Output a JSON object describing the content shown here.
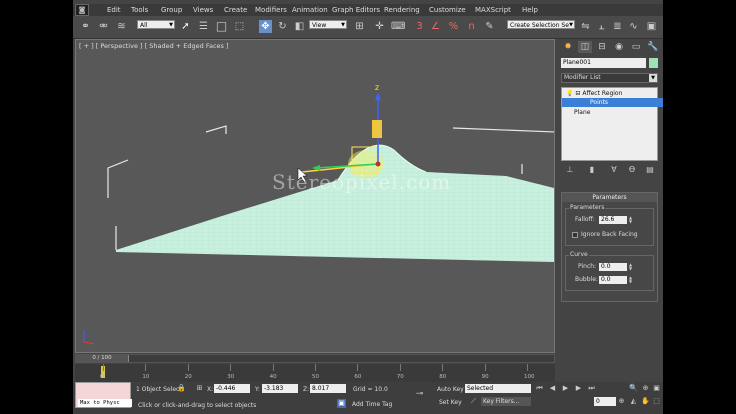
{
  "menu": {
    "items": [
      "Edit",
      "Tools",
      "Group",
      "Views",
      "Create",
      "Modifiers",
      "Animation",
      "Graph Editors",
      "Rendering",
      "Customize",
      "MAXScript",
      "Help"
    ]
  },
  "toolbar": {
    "selection_filter": "All",
    "reference_coord": "View",
    "named_selection_placeholder": "Create Selection Se",
    "snap_labels": [
      "3",
      "%",
      "n"
    ]
  },
  "viewport": {
    "label": "[ + ] [ Perspective ] [ Shaded + Edged Faces ]",
    "watermark": "Stereopixel.com",
    "gizmo_axis_label": "Z"
  },
  "command_panel": {
    "object_name": "Plane001",
    "object_color": "#9fe3b4",
    "modifier_list_label": "Modifier List",
    "stack": [
      {
        "label": "Affect Region",
        "selected": false,
        "indent": 1
      },
      {
        "label": "Points",
        "selected": true,
        "indent": 2
      },
      {
        "label": "Plane",
        "selected": false,
        "indent": 0
      }
    ],
    "rollout_title": "Parameters",
    "params_group": "Parameters",
    "falloff_label": "Falloff:",
    "falloff_value": "26.6",
    "ignore_back_facing": "Ignore Back Facing",
    "curve_group": "Curve",
    "pinch_label": "Pinch:",
    "pinch_value": "0.0",
    "bubble_label": "Bubble:",
    "bubble_value": "0.0"
  },
  "timeline": {
    "frame_readout": "0 / 100",
    "ticks": [
      "0",
      "10",
      "20",
      "30",
      "40",
      "50",
      "60",
      "70",
      "80",
      "90",
      "100"
    ]
  },
  "status": {
    "maxscript_text": "Max to Physc",
    "selection_count": "1 Object Selec",
    "x_label": "X:",
    "x_value": "-0.446",
    "y_label": "Y:",
    "y_value": "-3.183",
    "z_label": "Z:",
    "z_value": "8.017",
    "grid": "Grid = 10.0",
    "prompt": "Click or click-and-drag to select objects",
    "add_time_tag": "Add Time Tag",
    "auto_key": "Auto Key",
    "set_key": "Set Key",
    "key_mode": "Selected",
    "key_filters": "Key Filters...",
    "current_frame": "0"
  }
}
